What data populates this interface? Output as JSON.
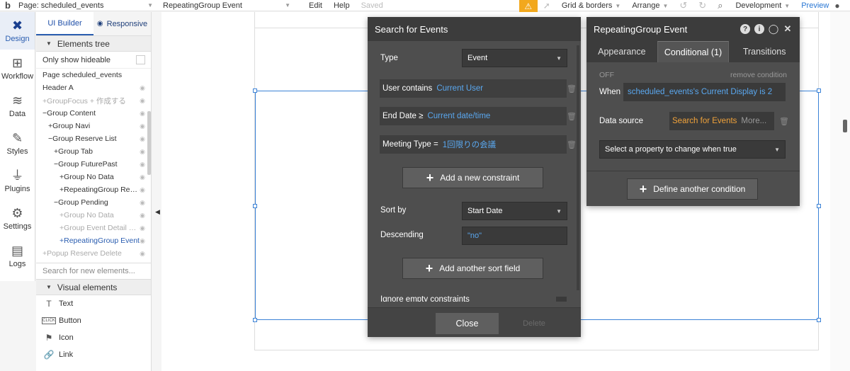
{
  "topbar": {
    "logo": "b",
    "page_label": "Page: scheduled_events",
    "element_select": "RepeatingGroup Event",
    "edit": "Edit",
    "help": "Help",
    "saved": "Saved",
    "grid": "Grid & borders",
    "arrange": "Arrange",
    "env": "Development",
    "preview": "Preview"
  },
  "iconbar": [
    {
      "label": "Design",
      "icon": "design-icon",
      "glyph": "✖",
      "active": true
    },
    {
      "label": "Workflow",
      "icon": "workflow-icon",
      "glyph": "⊞"
    },
    {
      "label": "Data",
      "icon": "database-icon",
      "glyph": "≋"
    },
    {
      "label": "Styles",
      "icon": "brush-icon",
      "glyph": "✎"
    },
    {
      "label": "Plugins",
      "icon": "plug-icon",
      "glyph": "⏚"
    },
    {
      "label": "Settings",
      "icon": "gear-icon",
      "glyph": "⚙"
    },
    {
      "label": "Logs",
      "icon": "document-icon",
      "glyph": "▤"
    }
  ],
  "panel": {
    "tab_ui": "UI Builder",
    "tab_responsive": "Responsive",
    "elements_tree": "Elements tree",
    "only_show": "Only show hideable",
    "tree": [
      {
        "label": "Page scheduled_events",
        "indent": 0,
        "state": "normal",
        "eye": false
      },
      {
        "label": "Header A",
        "indent": 0,
        "state": "normal",
        "eye": true
      },
      {
        "label": "+GroupFocus + 作成する",
        "indent": 0,
        "state": "dim",
        "eye": true
      },
      {
        "label": "−Group Content",
        "indent": 0,
        "state": "normal",
        "eye": true
      },
      {
        "label": "+Group Navi",
        "indent": 1,
        "state": "normal",
        "eye": true
      },
      {
        "label": "−Group Reserve List",
        "indent": 1,
        "state": "normal",
        "eye": true
      },
      {
        "label": "+Group Tab",
        "indent": 2,
        "state": "normal",
        "eye": true
      },
      {
        "label": "−Group FuturePast",
        "indent": 2,
        "state": "normal",
        "eye": true
      },
      {
        "label": "+Group No Data",
        "indent": 3,
        "state": "normal",
        "eye": true
      },
      {
        "label": "+RepeatingGroup Rese...",
        "indent": 3,
        "state": "normal",
        "eye": true
      },
      {
        "label": "−Group Pending",
        "indent": 2,
        "state": "normal",
        "eye": true
      },
      {
        "label": "+Group No Data",
        "indent": 3,
        "state": "dim",
        "eye": true
      },
      {
        "label": "+Group Event Detail Day",
        "indent": 3,
        "state": "dim",
        "eye": true
      },
      {
        "label": "+RepeatingGroup Event",
        "indent": 3,
        "state": "sel",
        "eye": true
      },
      {
        "label": "+Popup Reserve Delete",
        "indent": 0,
        "state": "dim",
        "eye": true
      }
    ],
    "search_placeholder": "Search for new elements...",
    "visual_elements": "Visual elements",
    "visual": [
      {
        "label": "Text",
        "icon": "text-icon",
        "glyph": "T"
      },
      {
        "label": "Button",
        "icon": "button-icon",
        "glyph": "CLICK"
      },
      {
        "label": "Icon",
        "icon": "flag-icon",
        "glyph": "⚑"
      },
      {
        "label": "Link",
        "icon": "link-icon",
        "glyph": "🔗"
      }
    ]
  },
  "search_dialog": {
    "title": "Search for Events",
    "type_label": "Type",
    "type_value": "Event",
    "constraints": [
      {
        "key": "User contains",
        "value": "Current User"
      },
      {
        "key": "End Date ≥",
        "value": "Current date/time"
      },
      {
        "key": "Meeting Type =",
        "value": "1回限りの会議"
      }
    ],
    "add_constraint": "Add a new constraint",
    "sort_label": "Sort by",
    "sort_value": "Start Date",
    "descending_label": "Descending",
    "descending_value": "\"no\"",
    "add_sort": "Add another sort field",
    "ignore_empty": "Ignore empty constraints",
    "close": "Close",
    "delete": "Delete"
  },
  "rg_dialog": {
    "title": "RepeatingGroup Event",
    "tabs": [
      "Appearance",
      "Conditional (1)",
      "Transitions"
    ],
    "off": "OFF",
    "remove": "remove condition",
    "when_label": "When",
    "when_value": "scheduled_events's Current Display is 2",
    "ds_label": "Data source",
    "ds_value": "Search for Events",
    "ds_more": "More...",
    "select_property": "Select a property to change when true",
    "define": "Define another condition"
  }
}
